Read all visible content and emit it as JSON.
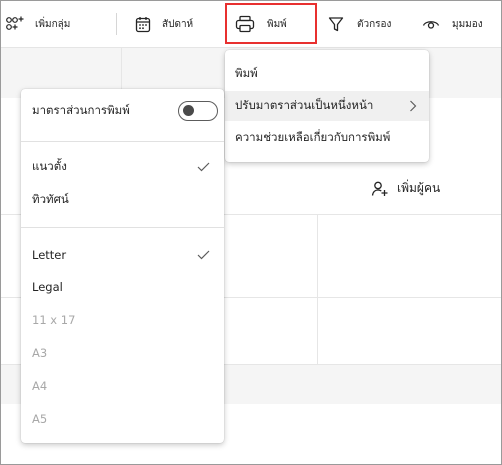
{
  "toolbar": {
    "add_group_label": "เพิ่มกลุ่ม",
    "week_label": "สัปดาห์",
    "print_label": "พิมพ์",
    "filter_label": "ตัวกรอง",
    "view_label": "มุมมอง"
  },
  "print_menu": {
    "items": [
      {
        "label": "พิมพ์"
      },
      {
        "label": "ปรับมาตราส่วนเป็นหนึ่งหน้า"
      },
      {
        "label": "ความช่วยเหลือเกี่ยวกับการพิมพ์"
      }
    ]
  },
  "scale_menu": {
    "print_scale_label": "มาตราส่วนการพิมพ์",
    "print_scale_enabled": false,
    "orientation": [
      {
        "label": "แนวตั้ง",
        "checked": true
      },
      {
        "label": "ทิวทัศน์",
        "checked": false
      }
    ],
    "paper_sizes": [
      {
        "label": "Letter",
        "checked": true,
        "enabled": true
      },
      {
        "label": "Legal",
        "checked": false,
        "enabled": true
      },
      {
        "label": "11 x 17",
        "checked": false,
        "enabled": false
      },
      {
        "label": "A3",
        "checked": false,
        "enabled": false
      },
      {
        "label": "A4",
        "checked": false,
        "enabled": false
      },
      {
        "label": "A5",
        "checked": false,
        "enabled": false
      }
    ]
  },
  "grid": {
    "add_person_label": "เพิ่มผู้คน"
  },
  "colors": {
    "highlight": "#e8302f",
    "accent_text": "#242424",
    "disabled_text": "#a8a8a8"
  }
}
